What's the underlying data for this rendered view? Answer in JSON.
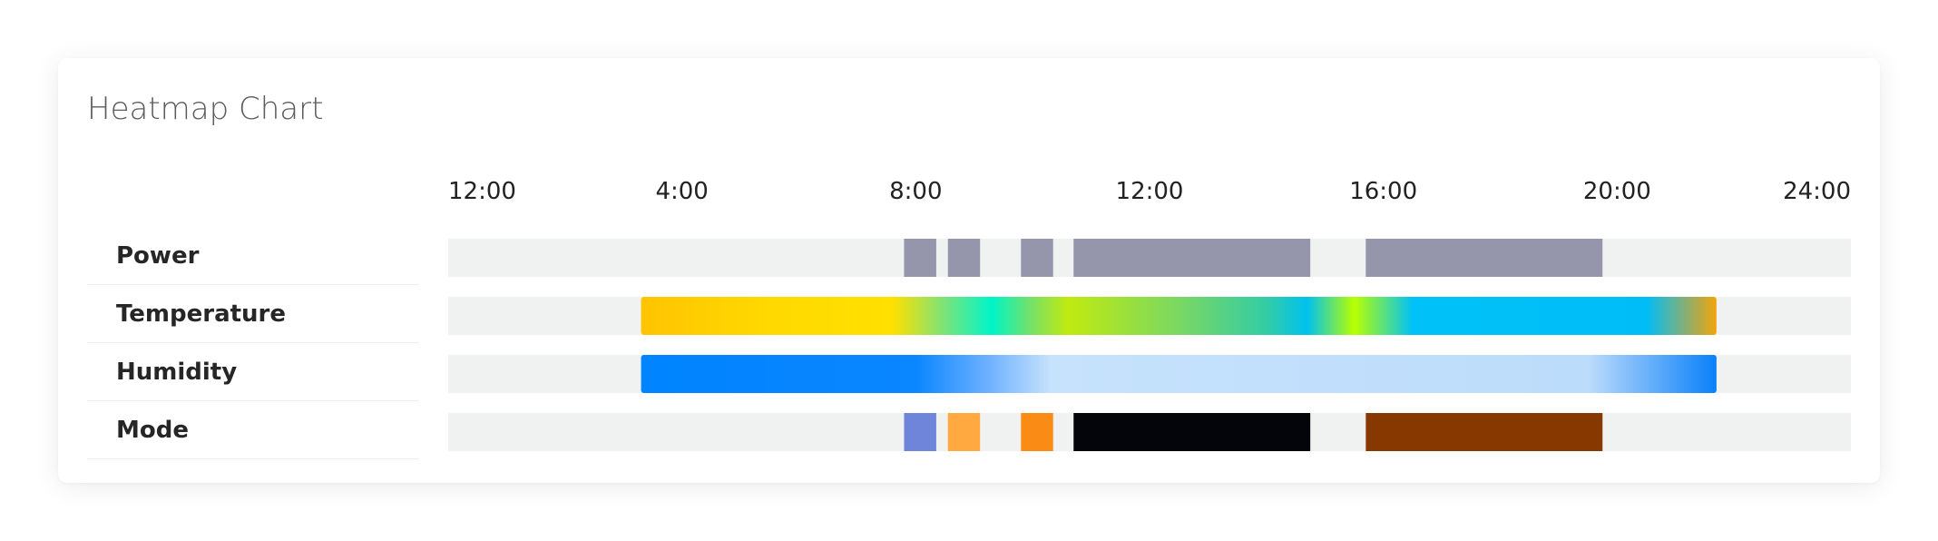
{
  "card": {
    "title": "Heatmap Chart"
  },
  "colors": {
    "track": "#eff2f1",
    "card_bg": "#ffffff"
  },
  "chart_data": {
    "type": "heatmap",
    "title": "Heatmap Chart",
    "x_range": [
      0,
      24
    ],
    "x_ticks": [
      {
        "value": 0,
        "label": "12:00"
      },
      {
        "value": 4,
        "label": "4:00"
      },
      {
        "value": 8,
        "label": "8:00"
      },
      {
        "value": 12,
        "label": "12:00"
      },
      {
        "value": 16,
        "label": "16:00"
      },
      {
        "value": 20,
        "label": "20:00"
      },
      {
        "value": 24,
        "label": "24:00"
      }
    ],
    "rows": [
      {
        "label": "Power",
        "kind": "segments",
        "segments": [
          {
            "start": 7.8,
            "end": 8.35,
            "color": "#9595ac"
          },
          {
            "start": 8.55,
            "end": 9.1,
            "color": "#9595ac"
          },
          {
            "start": 9.8,
            "end": 10.35,
            "color": "#9595ac"
          },
          {
            "start": 10.7,
            "end": 14.75,
            "color": "#9595ac"
          },
          {
            "start": 15.7,
            "end": 19.75,
            "color": "#9595ac"
          }
        ]
      },
      {
        "label": "Temperature",
        "kind": "gradient",
        "start": 3.3,
        "end": 21.7,
        "stops": [
          {
            "at": 3.3,
            "color": "#ffc400"
          },
          {
            "at": 5.5,
            "color": "#ffd900"
          },
          {
            "at": 7.6,
            "color": "#ffe000"
          },
          {
            "at": 8.5,
            "color": "#7ae37a"
          },
          {
            "at": 9.3,
            "color": "#00f5c8"
          },
          {
            "at": 10.0,
            "color": "#7ae064"
          },
          {
            "at": 10.6,
            "color": "#c0ea10"
          },
          {
            "at": 12.5,
            "color": "#7ad862"
          },
          {
            "at": 14.0,
            "color": "#33cca5"
          },
          {
            "at": 14.7,
            "color": "#00c2ef"
          },
          {
            "at": 15.5,
            "color": "#b8ff00"
          },
          {
            "at": 16.5,
            "color": "#00c2f8"
          },
          {
            "at": 20.5,
            "color": "#00bdf8"
          },
          {
            "at": 21.7,
            "color": "#f2a40c"
          }
        ]
      },
      {
        "label": "Humidity",
        "kind": "gradient",
        "start": 3.3,
        "end": 21.7,
        "stops": [
          {
            "at": 3.3,
            "color": "#0084ff"
          },
          {
            "at": 8.0,
            "color": "#0a86ff"
          },
          {
            "at": 9.2,
            "color": "#6aafff"
          },
          {
            "at": 10.3,
            "color": "#c6e2fc"
          },
          {
            "at": 19.5,
            "color": "#bcdcfb"
          },
          {
            "at": 21.7,
            "color": "#0a80fa"
          }
        ]
      },
      {
        "label": "Mode",
        "kind": "segments",
        "segments": [
          {
            "start": 7.8,
            "end": 8.35,
            "color": "#6f85d9"
          },
          {
            "start": 8.55,
            "end": 9.1,
            "color": "#ffa940"
          },
          {
            "start": 9.8,
            "end": 10.35,
            "color": "#fa8c16"
          },
          {
            "start": 10.7,
            "end": 14.75,
            "color": "#03050a"
          },
          {
            "start": 15.7,
            "end": 19.75,
            "color": "#873800"
          }
        ]
      }
    ]
  }
}
